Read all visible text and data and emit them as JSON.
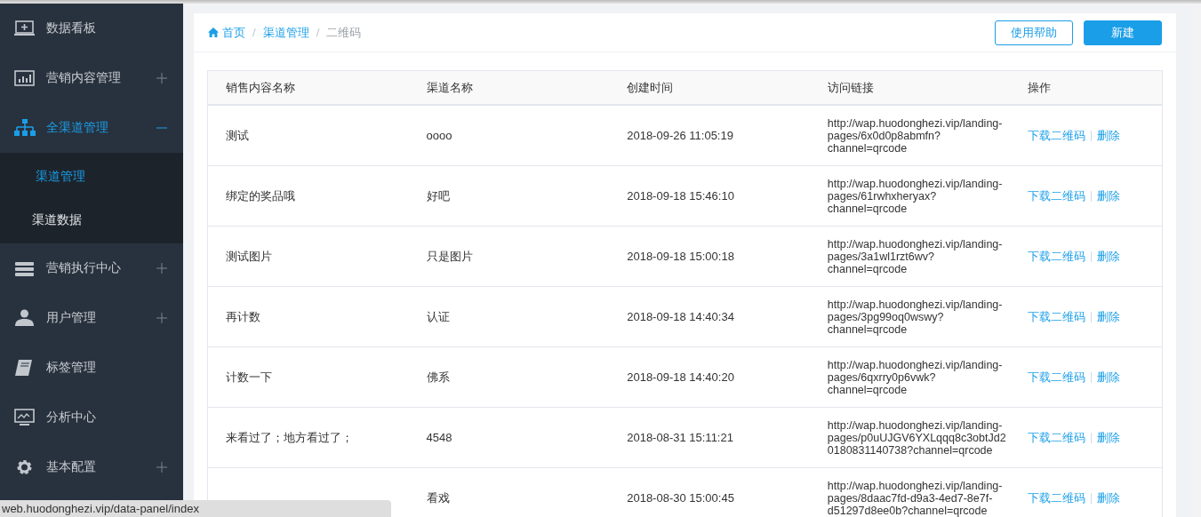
{
  "sidebar": {
    "items": [
      {
        "label": "数据看板",
        "selected": false
      },
      {
        "label": "营销内容管理",
        "selected": false,
        "expanded": false
      },
      {
        "label": "全渠道管理",
        "selected": true,
        "expanded": true,
        "children": [
          {
            "label": "渠道管理",
            "selected": true
          },
          {
            "label": "渠道数据",
            "selected": false
          }
        ]
      },
      {
        "label": "营销执行中心",
        "selected": false,
        "expanded": false
      },
      {
        "label": "用户管理",
        "selected": false,
        "expanded": false
      },
      {
        "label": "标签管理",
        "selected": false
      },
      {
        "label": "分析中心",
        "selected": false
      },
      {
        "label": "基本配置",
        "selected": false,
        "expanded": false
      }
    ]
  },
  "breadcrumb": [
    {
      "text": "首页",
      "kind": "home"
    },
    {
      "text": "/",
      "kind": "separator"
    },
    {
      "text": "渠道管理",
      "kind": "link"
    },
    {
      "text": "/",
      "kind": "separator"
    },
    {
      "text": "二维码",
      "kind": "current"
    }
  ],
  "buttons": [
    {
      "label": "使用帮助",
      "kind": "outline"
    },
    {
      "label": "新建",
      "kind": "primary"
    }
  ],
  "table": {
    "columns": [
      "销售内容名称",
      "渠道名称",
      "创建时间",
      "访问链接",
      "操作"
    ],
    "rows": [
      {
        "name": "测试",
        "channel": "oooo",
        "created": "2018-09-26 11:05:19",
        "link": "http://wap.huodonghezi.vip/landing-pages/6x0d0p8abmfn?channel=qrcode",
        "actions": [
          "下载二维码",
          "删除"
        ]
      },
      {
        "name": "绑定的奖品哦",
        "channel": "好吧",
        "created": "2018-09-18 15:46:10",
        "link": "http://wap.huodonghezi.vip/landing-pages/61rwhxheryax?channel=qrcode",
        "actions": [
          "下载二维码",
          "删除"
        ]
      },
      {
        "name": "测试图片",
        "channel": "只是图片",
        "created": "2018-09-18 15:00:18",
        "link": "http://wap.huodonghezi.vip/landing-pages/3a1wl1rzt6wv?channel=qrcode",
        "actions": [
          "下载二维码",
          "删除"
        ]
      },
      {
        "name": "再计数",
        "channel": "认证",
        "created": "2018-09-18 14:40:34",
        "link": "http://wap.huodonghezi.vip/landing-pages/3pg99oq0wswy?channel=qrcode",
        "actions": [
          "下载二维码",
          "删除"
        ]
      },
      {
        "name": "计数一下",
        "channel": "佛系",
        "created": "2018-09-18 14:40:20",
        "link": "http://wap.huodonghezi.vip/landing-pages/6qxrry0p6vwk?channel=qrcode",
        "actions": [
          "下载二维码",
          "删除"
        ]
      },
      {
        "name": "来看过了；地方看过了；",
        "channel": "4548",
        "created": "2018-08-31 15:11:21",
        "link": "http://wap.huodonghezi.vip/landing-pages/p0uUJGV6YXLqqq8c3obtJd20180831140738?channel=qrcode",
        "actions": [
          "下载二维码",
          "删除"
        ]
      },
      {
        "channel": "看戏",
        "created": "2018-08-30 15:00:45",
        "link": "http://wap.huodonghezi.vip/landing-pages/8daac7fd-d9a3-4ed7-8e7f-d51297d8ee0b?channel=qrcode",
        "actions": [
          "下载二维码",
          "删除"
        ]
      }
    ]
  },
  "status_bar": "web.huodonghezi.vip/data-panel/index"
}
